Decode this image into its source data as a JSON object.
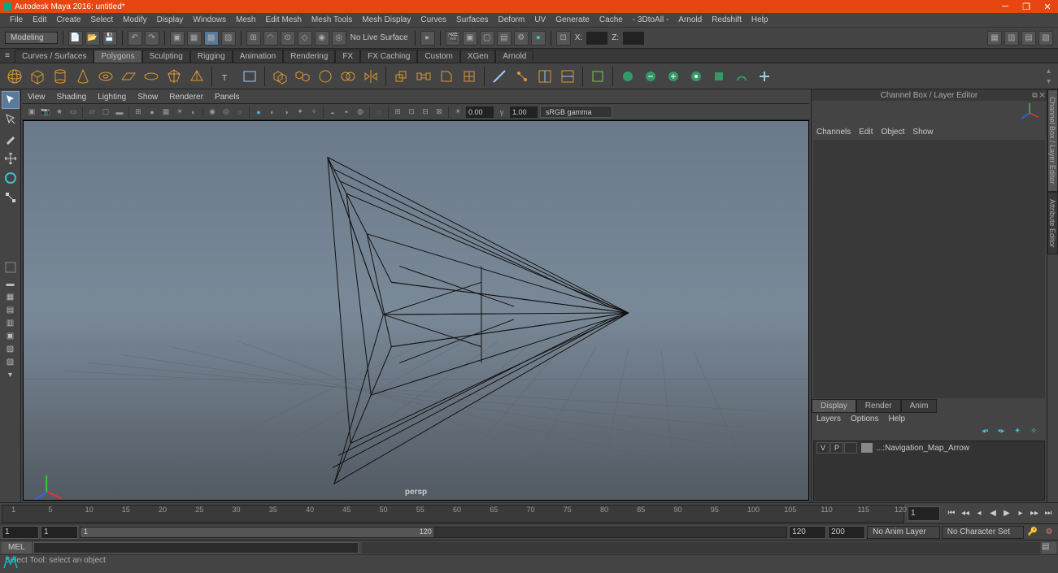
{
  "title": "Autodesk Maya 2016: untitled*",
  "menus": [
    "File",
    "Edit",
    "Create",
    "Select",
    "Modify",
    "Display",
    "Windows",
    "Mesh",
    "Edit Mesh",
    "Mesh Tools",
    "Mesh Display",
    "Curves",
    "Surfaces",
    "Deform",
    "UV",
    "Generate",
    "Cache",
    "- 3DtoAll -",
    "Arnold",
    "Redshift",
    "Help"
  ],
  "workspace": "Modeling",
  "statusbar": {
    "noLive": "No Live Surface",
    "xLabel": "X:",
    "zLabel": "Z:"
  },
  "shelfTabs": [
    "Curves / Surfaces",
    "Polygons",
    "Sculpting",
    "Rigging",
    "Animation",
    "Rendering",
    "FX",
    "FX Caching",
    "Custom",
    "XGen",
    "Arnold"
  ],
  "activeShelfTab": 1,
  "panelMenus": [
    "View",
    "Shading",
    "Lighting",
    "Show",
    "Renderer",
    "Panels"
  ],
  "panelTools": {
    "exp1": "0.00",
    "exp2": "1.00",
    "gamma": "sRGB gamma"
  },
  "camera": "persp",
  "channelBox": {
    "title": "Channel Box / Layer Editor",
    "menus": [
      "Channels",
      "Edit",
      "Object",
      "Show"
    ]
  },
  "displayTabs": [
    "Display",
    "Render",
    "Anim"
  ],
  "layerMenus": [
    "Layers",
    "Options",
    "Help"
  ],
  "layer": {
    "v": "V",
    "p": "P",
    "name": "...:Navigation_Map_Arrow"
  },
  "time": {
    "current": "1",
    "start": "1",
    "end": "120",
    "rangeStart": "1",
    "rangeEnd": "120",
    "animStart": "1",
    "animEnd": "200"
  },
  "animLayer": "No Anim Layer",
  "charSet": "No Character Set",
  "cmd": "MEL",
  "help": "Select Tool: select an object",
  "timeTicks": [
    "1",
    "5",
    "10",
    "15",
    "20",
    "25",
    "30",
    "35",
    "40",
    "45",
    "50",
    "55",
    "60",
    "65",
    "70",
    "75",
    "80",
    "85",
    "90",
    "95",
    "100",
    "105",
    "110",
    "115",
    "120"
  ],
  "rtabs": [
    "Channel Box / Layer Editor",
    "Attribute Editor"
  ]
}
